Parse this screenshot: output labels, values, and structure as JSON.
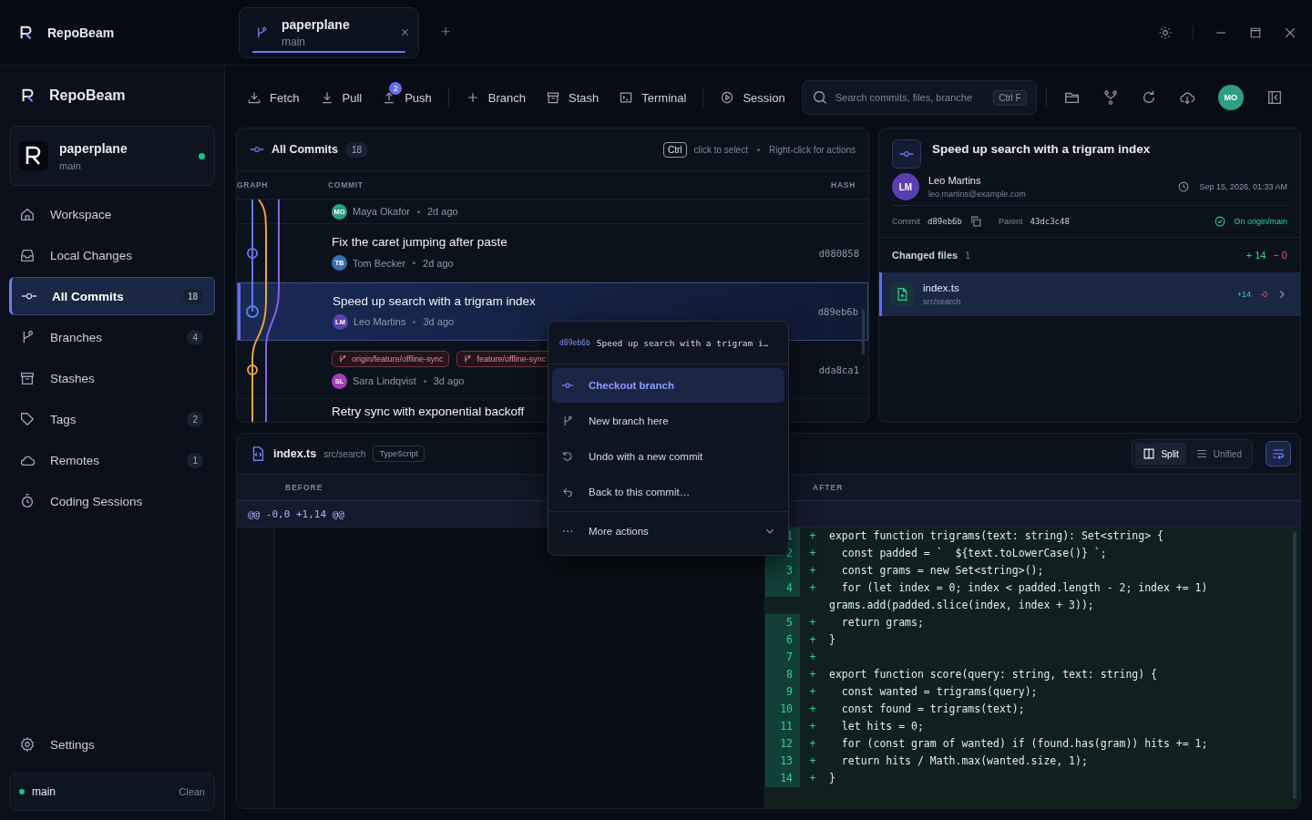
{
  "titlebar": {
    "app_name": "RepoBeam",
    "tab": {
      "title": "paperplane",
      "subtitle": "main",
      "close": "×"
    },
    "new_tab": "+"
  },
  "sidebar": {
    "app_name": "RepoBeam",
    "repo": {
      "name": "paperplane",
      "branch": "main"
    },
    "items": [
      {
        "label": "Workspace",
        "selected": false
      },
      {
        "label": "Local Changes",
        "selected": false
      },
      {
        "label": "All Commits",
        "count": "18",
        "selected": true
      },
      {
        "label": "Branches",
        "count": "4",
        "selected": false
      },
      {
        "label": "Stashes",
        "selected": false
      },
      {
        "label": "Tags",
        "count": "2",
        "selected": false
      },
      {
        "label": "Remotes",
        "count": "1",
        "selected": false
      },
      {
        "label": "Coding Sessions",
        "selected": false
      }
    ],
    "settings": "Settings",
    "status": {
      "branch": "main",
      "state": "Clean"
    }
  },
  "toolbar": {
    "groups": [
      [
        {
          "label": "Fetch"
        },
        {
          "label": "Pull"
        },
        {
          "label": "Push",
          "badge": "2"
        }
      ],
      [
        {
          "label": "Branch"
        },
        {
          "label": "Stash"
        },
        {
          "label": "Terminal"
        }
      ],
      [
        {
          "label": "Session"
        }
      ]
    ],
    "search": {
      "placeholder": "Search commits, files, branche",
      "shortcut": "Ctrl F"
    },
    "avatar": "MO"
  },
  "commits": {
    "title": "All Commits",
    "count": "18",
    "hint_key": "Ctrl",
    "hint_select": "click to select",
    "hint_actions": "Right-click for actions",
    "columns": [
      "GRAPH",
      "COMMIT",
      "HASH"
    ],
    "rows": [
      {
        "author": "Maya Okafor",
        "initials": "MO",
        "color": "#2f9e86",
        "time": "2d ago",
        "selected": false
      },
      {
        "title": "Fix the caret jumping after paste",
        "author": "Tom Becker",
        "initials": "TB",
        "color": "#3b6fb6",
        "time": "2d ago",
        "hash": "d080858",
        "selected": false
      },
      {
        "title": "Speed up search with a trigram index",
        "author": "Leo Martins",
        "initials": "LM",
        "color": "#5b3fb0",
        "time": "3d ago",
        "hash": "d89eb6b",
        "selected": true
      },
      {
        "refs": [
          "origin/feature/offline-sync",
          "feature/offline-sync"
        ],
        "author": "Sara Lindqvist",
        "initials": "SL",
        "color": "#a23fb8",
        "time": "3d ago",
        "hash": "dda8ca1",
        "selected": false
      },
      {
        "title": "Retry sync with exponential backoff",
        "selected": false
      }
    ]
  },
  "details": {
    "title": "Speed up search with a trigram index",
    "author": "Leo Martins",
    "initials": "LM",
    "email": "leo.martins@example.com",
    "date": "Sep 15, 2026, 01:33 AM",
    "commit_label": "Commit",
    "commit": "d89eb6b",
    "parent_label": "Parent",
    "parent": "43dc3c48",
    "remote": "On origin/main",
    "changed_label": "Changed files",
    "changed_count": "1",
    "added": "+ 14",
    "removed": "− 0",
    "files": [
      {
        "name": "index.ts",
        "path": "src/search",
        "added": "+14",
        "removed": "-0",
        "selected": true
      }
    ]
  },
  "diff": {
    "file": "index.ts",
    "path": "src/search",
    "language": "TypeScript",
    "views": [
      {
        "label": "Split",
        "selected": true
      },
      {
        "label": "Unified",
        "selected": false
      }
    ],
    "wrap": true,
    "before_label": "BEFORE",
    "after_label": "AFTER",
    "hunk": "@@ -0,0 +1,14 @@",
    "lines": [
      {
        "n": "1",
        "code": "export function trigrams(text: string): Set<string> {"
      },
      {
        "n": "2",
        "code": "  const padded = `  ${text.toLowerCase()} `;"
      },
      {
        "n": "3",
        "code": "  const grams = new Set<string>();"
      },
      {
        "n": "4",
        "code": "  for (let index = 0; index < padded.length - 2; index += 1) grams.add(padded.slice(index, index + 3));"
      },
      {
        "n": "5",
        "code": "  return grams;"
      },
      {
        "n": "6",
        "code": "}"
      },
      {
        "n": "7"
      },
      {
        "n": "8",
        "code": "export function score(query: string, text: string) {"
      },
      {
        "n": "9",
        "code": "  const wanted = trigrams(query);"
      },
      {
        "n": "10",
        "code": "  const found = trigrams(text);"
      },
      {
        "n": "11",
        "code": "  let hits = 0;"
      },
      {
        "n": "12",
        "code": "  for (const gram of wanted) if (found.has(gram)) hits += 1;"
      },
      {
        "n": "13",
        "code": "  return hits / Math.max(wanted.size, 1);"
      },
      {
        "n": "14",
        "code": "}"
      }
    ],
    "sign": "+"
  },
  "context_menu": {
    "hash": "d89eb6b",
    "subject": "Speed up search with a trigram i…",
    "items": [
      {
        "label": "Checkout branch",
        "selected": true
      },
      {
        "label": "New branch here",
        "selected": false
      },
      {
        "label": "Undo with a new commit",
        "selected": false
      },
      {
        "label": "Back to this commit…",
        "selected": false
      }
    ],
    "more": "More actions"
  }
}
